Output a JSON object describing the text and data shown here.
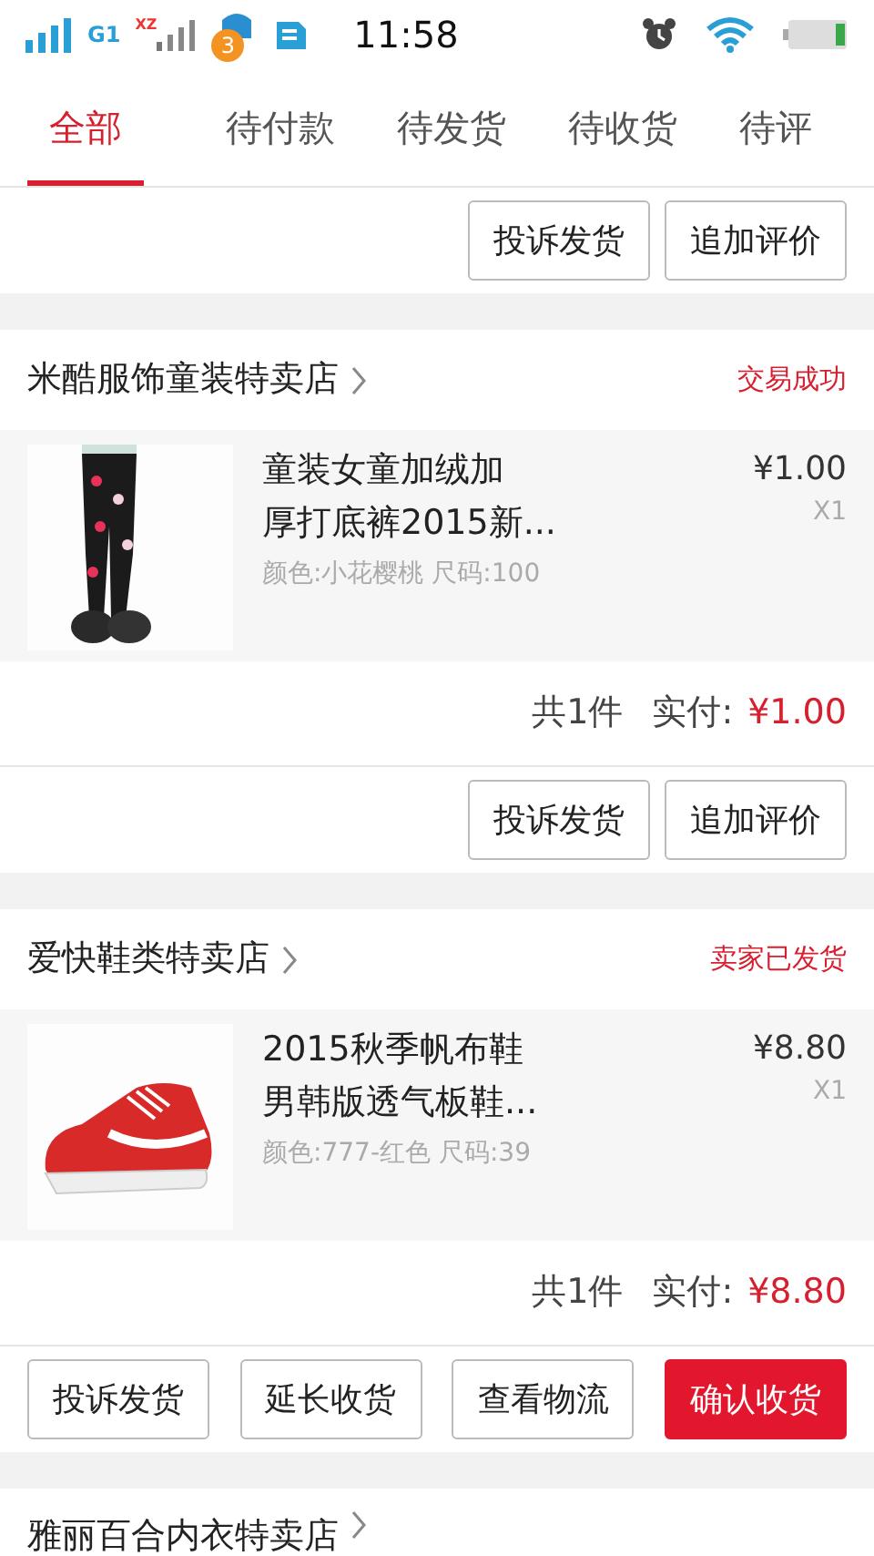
{
  "status_bar": {
    "network": "G1",
    "carrier_mark": "XZ",
    "notification_count": "3",
    "time": "11:58"
  },
  "tabs": [
    {
      "label": "全部",
      "selected": true
    },
    {
      "label": "待付款",
      "selected": false
    },
    {
      "label": "待发货",
      "selected": false
    },
    {
      "label": "待收货",
      "selected": false
    },
    {
      "label": "待评",
      "selected": false
    }
  ],
  "orders": [
    {
      "buttons": [
        {
          "label": "投诉发货",
          "kind": "outline"
        },
        {
          "label": "追加评价",
          "kind": "outline"
        }
      ]
    },
    {
      "shop": "米酷服饰童装特卖店",
      "status": "交易成功",
      "items": [
        {
          "kind": "picture",
          "title_lines": [
            "童装女童加绒加",
            "厚打底裤2015新..."
          ],
          "spec": "颜色:小花樱桃 尺码:100",
          "price": "¥1.00",
          "quantity": "X1"
        }
      ],
      "count": "共1件",
      "paid_label": "实付:",
      "paid": "¥1.00",
      "buttons": [
        {
          "label": "投诉发货",
          "kind": "outline"
        },
        {
          "label": "追加评价",
          "kind": "outline"
        }
      ]
    },
    {
      "shop": "爱快鞋类特卖店",
      "status": "卖家已发货",
      "items": [
        {
          "kind": "picture",
          "title_lines": [
            "2015秋季帆布鞋",
            "男韩版透气板鞋..."
          ],
          "spec": "颜色:777-红色 尺码:39",
          "price": "¥8.80",
          "quantity": "X1"
        }
      ],
      "count": "共1件",
      "paid_label": "实付:",
      "paid": "¥8.80",
      "buttons": [
        {
          "label": "投诉发货",
          "kind": "outline"
        },
        {
          "label": "延长收货",
          "kind": "outline"
        },
        {
          "label": "查看物流",
          "kind": "outline"
        },
        {
          "label": "确认收货",
          "kind": "primary"
        }
      ]
    },
    {
      "shop": "雅丽百合内衣特卖店"
    }
  ]
}
